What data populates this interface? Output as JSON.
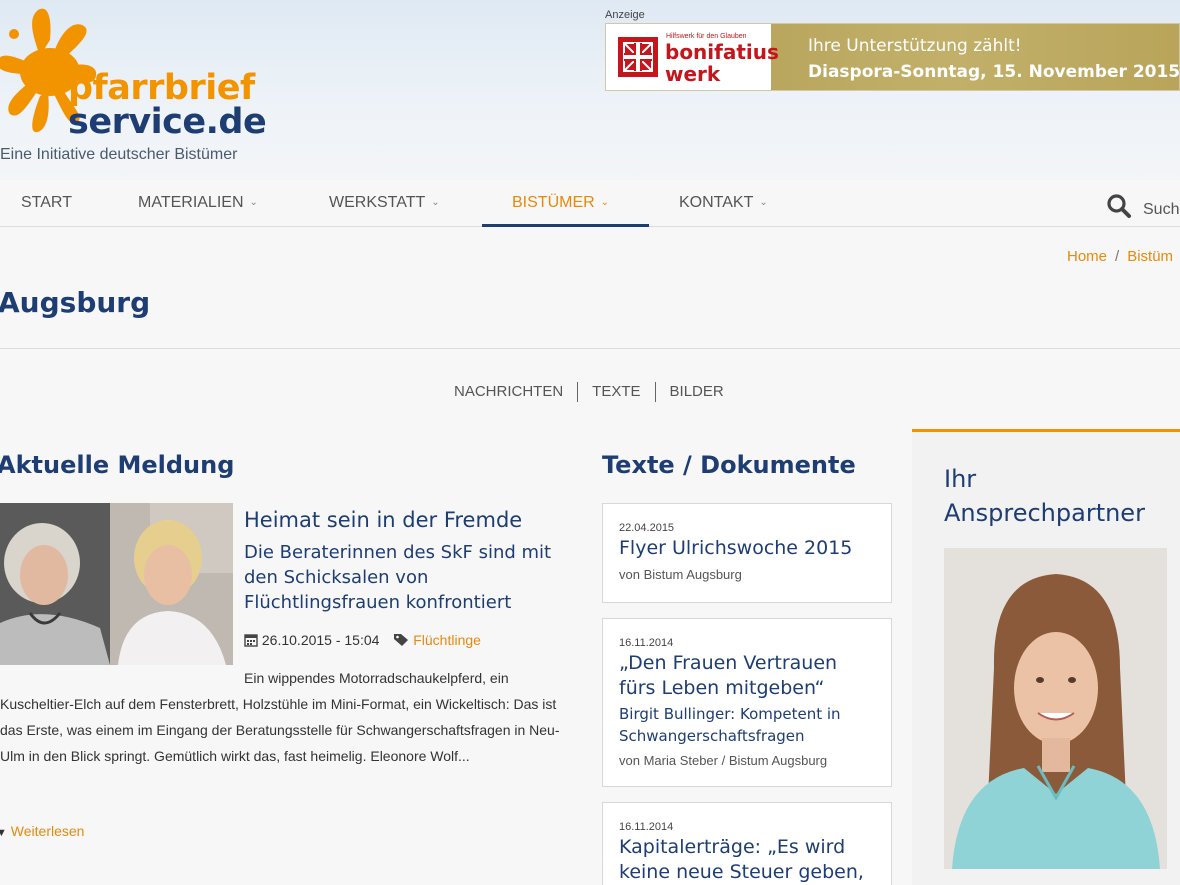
{
  "header": {
    "logo": {
      "word1": "pfarrbrief",
      "word2": "service.de",
      "tagline": "Eine Initiative deutscher Bistümer"
    },
    "ad": {
      "label": "Anzeige",
      "org_small": "Hilfswerk für den Glauben",
      "org_name1": "bonifatius",
      "org_name2": "werk",
      "line1": "Ihre Unterstützung zählt!",
      "line2": "Diaspora-Sonntag, 15. November 2015"
    }
  },
  "nav": {
    "items": [
      {
        "label": "START"
      },
      {
        "label": "MATERIALIEN"
      },
      {
        "label": "WERKSTATT"
      },
      {
        "label": "BISTÜMER"
      },
      {
        "label": "KONTAKT"
      }
    ],
    "search_label": "Such"
  },
  "breadcrumb": {
    "home": "Home",
    "sep": "/",
    "current": "Bistüm"
  },
  "page": {
    "title": "Augsburg"
  },
  "subnav": {
    "items": [
      "NACHRICHTEN",
      "TEXTE",
      "BILDER"
    ]
  },
  "news": {
    "section_title": "Aktuelle Meldung",
    "title": "Heimat sein in der Fremde",
    "subtitle": "Die Beraterinnen des SkF sind mit den Schicksalen von Flüchtlingsfrauen konfrontiert",
    "date": "26.10.2015 - 15:04",
    "tag": "Flüchtlinge",
    "body_first": "Ein wippendes Motorradschaukelpferd, ein",
    "body_rest": "Kuscheltier-Elch auf dem Fensterbrett, Holzstühle im Mini-Format, ein Wickeltisch: Das ist das Erste, was einem im Eingang der Beratungsstelle für Schwangerschaftsfragen in Neu-Ulm in den Blick springt. Gemütlich wirkt das, fast heimelig. Eleonore Wolf...",
    "read_more": "Weiterlesen"
  },
  "documents": {
    "section_title": "Texte / Dokumente",
    "items": [
      {
        "date": "22.04.2015",
        "title": "Flyer Ulrichswoche 2015",
        "subtitle": "",
        "author": "von Bistum Augsburg"
      },
      {
        "date": "16.11.2014",
        "title": "„Den Frauen Vertrauen fürs Leben mitgeben“",
        "subtitle": "Birgit Bullinger: Kompetent in Schwangerschaftsfragen",
        "author": "von Maria Steber / Bistum Augsburg"
      },
      {
        "date": "16.11.2014",
        "title": "Kapitalerträge: „Es wird keine neue Steuer geben,",
        "subtitle": "",
        "author": ""
      }
    ]
  },
  "sidebar": {
    "title": "Ihr Ansprechpartner"
  },
  "colors": {
    "brand_blue": "#1e3d73",
    "brand_orange": "#f29400",
    "link_orange": "#e8890c",
    "ad_gold": "#b29d52",
    "ad_red": "#c4161c"
  },
  "icons": {
    "search": "search-icon",
    "calendar": "calendar-icon",
    "tag": "tag-icon",
    "chevron": "chevron-down-icon"
  }
}
